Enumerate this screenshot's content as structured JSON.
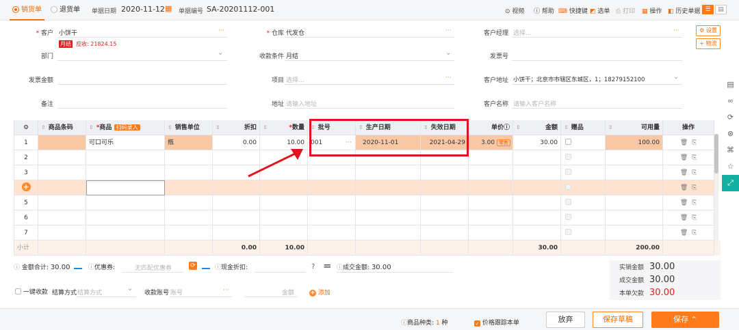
{
  "topbar": {
    "tab_sales": "销货单",
    "tab_return": "退货单",
    "date_label": "单据日期",
    "date_value": "2020-11-12",
    "number_label": "单据编号",
    "number_value": "SA-20201112-001",
    "video": "视频",
    "help": "帮助",
    "shortcut": "快捷键",
    "select_doc": "选单",
    "print": "打印",
    "operate": "操作",
    "history": "历史单据"
  },
  "form": {
    "customer_label": "客户",
    "customer_value": "小饼干",
    "monthly_tag": "月结",
    "receivable": "应收: 21824.15",
    "dept_label": "部门",
    "warehouse_label": "仓库",
    "warehouse_value": "代发仓",
    "terms_label": "收款条件",
    "terms_value": "月结",
    "manager_label": "客户经理",
    "manager_placeholder": "选择...",
    "invoice_no_label": "发票号",
    "invoice_amt_label": "发票金额",
    "project_label": "项目",
    "project_placeholder": "选择...",
    "cust_addr_label": "客户地址",
    "cust_addr_value": "小饼干；北京市市辖区东城区，1；18279152100",
    "remark_label": "备注",
    "addr_label": "地址",
    "addr_placeholder": "请输入地址",
    "cust_name_label": "客户名称",
    "cust_name_placeholder": "请输入客户名称",
    "btn_settings": "设置",
    "btn_logistics": "物流"
  },
  "table": {
    "headers": {
      "barcode": "商品条码",
      "product": "商品",
      "scan_tag": "扫码录入",
      "unit": "销售单位",
      "discount": "折扣",
      "qty": "数量",
      "batch": "批号",
      "prod_date": "生产日期",
      "exp_date": "失效日期",
      "price": "单价",
      "amount": "金额",
      "gift": "赠品",
      "available": "可用量",
      "ops": "操作"
    },
    "row1": {
      "no": "1",
      "product": "可口可乐",
      "unit": "瓶",
      "discount": "0.00",
      "qty": "10.00",
      "batch": "001",
      "prod_date": "2020-11-01",
      "exp_date": "2021-04-29",
      "price": "3.00",
      "price_tag": "零售",
      "amount": "30.00",
      "available": "100.00"
    },
    "row_nums": [
      "2",
      "3",
      "5",
      "6",
      "7"
    ],
    "subtotal_label": "小计",
    "subtotal": {
      "discount": "0.00",
      "qty": "10.00",
      "amount": "30.00",
      "available": "200.00"
    }
  },
  "footer": {
    "total_label": "金额合计:",
    "total_value": "30.00",
    "coupon_label": "优惠券:",
    "coupon_placeholder": "无匹配优惠券",
    "cash_discount_label": "现金折扣:",
    "deal_label": "成交金额:",
    "deal_value": "30.00",
    "one_click": "一键收款",
    "settle_label": "结算方式",
    "settle_placeholder": "结算方式",
    "account_label": "收款账号",
    "account_placeholder": "账号",
    "amount_placeholder": "金额",
    "add": "添加",
    "actual_label": "实销金额",
    "actual_value": "30.00",
    "deal_amt_label": "成交金额",
    "deal_amt_value": "30.00",
    "owe_label": "本单欠款",
    "owe_value": "30.00"
  },
  "bottom": {
    "kinds_label": "商品种类:",
    "kinds_value": "1",
    "kinds_unit": "种",
    "price_track": "价格跟踪本单",
    "discard": "放弃",
    "save_draft": "保存草稿",
    "save": "保存"
  },
  "colors": {
    "accent": "#ff6a00",
    "highlight_box": "#e0141e",
    "arrow": "#e0141e"
  }
}
